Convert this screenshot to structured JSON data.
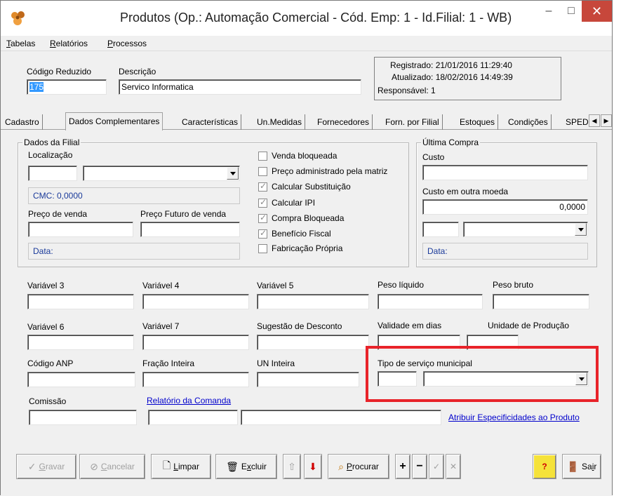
{
  "window": {
    "title": "Produtos (Op.: Automação Comercial - Cód. Emp: 1 - Id.Filial: 1 - WB)",
    "min_symbol": "–",
    "max_symbol": "□",
    "close_symbol": "✕"
  },
  "menu": {
    "items": [
      {
        "first": "T",
        "rest": "abelas"
      },
      {
        "first": "R",
        "rest": "elatórios"
      },
      {
        "first": "P",
        "rest": "rocessos"
      }
    ]
  },
  "header": {
    "codigo_label": "Código Reduzido",
    "codigo_value": "175",
    "descricao_label": "Descrição",
    "descricao_value": "Servico Informatica",
    "registrado": "Registrado: 21/01/2016 11:29:40",
    "atualizado": "Atualizado: 18/02/2016 14:49:39",
    "responsavel": "Responsável: 1"
  },
  "tabs": [
    "Cadastro",
    "Dados Complementares",
    "Características",
    "Un.Medidas",
    "Fornecedores",
    "Forn. por Filial",
    "Estoques",
    "Condições",
    "SPED"
  ],
  "tab_active_index": 1,
  "dados_filial": {
    "title": "Dados da Filial",
    "localizacao_label": "Localização",
    "cmc": "CMC:   0,0000",
    "preco_venda_label": "Preço de venda",
    "preco_futuro_label": "Preço Futuro de venda",
    "data_label": "Data:"
  },
  "checkboxes": [
    {
      "label": "Venda bloqueada",
      "checked": false
    },
    {
      "label": "Preço administrado pela matriz",
      "checked": false
    },
    {
      "label": "Calcular Substituição",
      "checked": true
    },
    {
      "label": "Calcular IPI",
      "checked": true
    },
    {
      "label": "Compra Bloqueada",
      "checked": true
    },
    {
      "label": "Benefício Fiscal",
      "checked": true
    },
    {
      "label": "Fabricação Própria",
      "checked": false
    }
  ],
  "ultima_compra": {
    "title": "Última Compra",
    "custo_label": "Custo",
    "custo_outra_label": "Custo em outra moeda",
    "custo_outra_value": "0,0000",
    "data_label": "Data:"
  },
  "fields": {
    "variavel3": "Variável 3",
    "variavel4": "Variável 4",
    "variavel5": "Variável 5",
    "peso_liquido": "Peso líquido",
    "peso_bruto": "Peso bruto",
    "variavel6": "Variável 6",
    "variavel7": "Variável 7",
    "sugestao_desconto": "Sugestão de Desconto",
    "validade_dias": "Validade em dias",
    "unidade_producao": "Unidade de Produção",
    "codigo_anp": "Código ANP",
    "fracao_inteira": "Fração Inteira",
    "un_inteira": "UN Inteira",
    "tipo_servico": "Tipo de serviço municipal",
    "comissao": "Comissão",
    "relatorio_comanda": "Relatório da Comanda",
    "atribuir_especificidades": "Atribuir Especificidades ao Produto"
  },
  "toolbar": {
    "gravar": {
      "first": "G",
      "rest": "ravar"
    },
    "cancelar": {
      "first": "C",
      "rest": "ancelar"
    },
    "limpar": {
      "first": "L",
      "rest": "impar"
    },
    "excluir_pre": "E",
    "excluir_u": "x",
    "excluir_post": "cluir",
    "procurar": {
      "first": "P",
      "rest": "rocurar"
    },
    "sair_pre": "Sa",
    "sair_u": "i",
    "sair_post": "r"
  },
  "colors": {
    "highlight": "#e8232a",
    "link": "#0000cc",
    "panel_text": "#1a3a9a"
  }
}
